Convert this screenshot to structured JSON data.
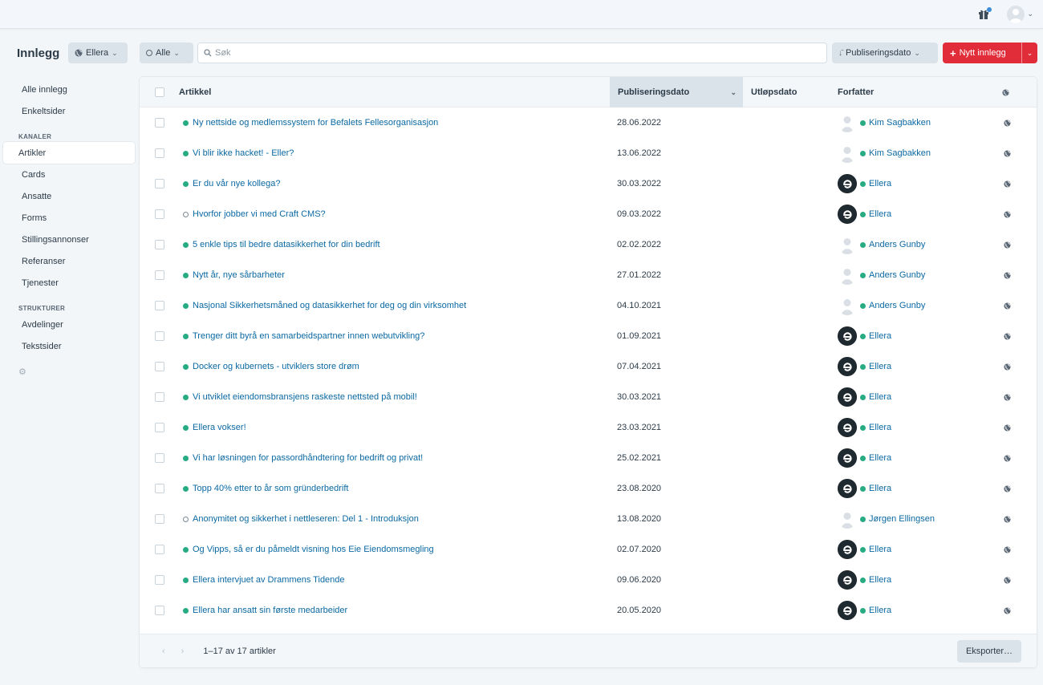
{
  "topbar": {
    "gift_icon": "gift-icon",
    "user_icon": "user-avatar"
  },
  "header": {
    "title": "Innlegg",
    "site_label": "Ellera",
    "status_label": "Alle",
    "search_placeholder": "Søk",
    "sort_label": "Publiseringsdato",
    "new_label": "Nytt innlegg"
  },
  "sidebar": {
    "top": [
      {
        "label": "Alle innlegg"
      },
      {
        "label": "Enkeltsider"
      }
    ],
    "kanaler_heading": "KANALER",
    "kanaler": [
      {
        "label": "Artikler",
        "selected": true
      },
      {
        "label": "Cards"
      },
      {
        "label": "Ansatte"
      },
      {
        "label": "Forms"
      },
      {
        "label": "Stillingsannonser"
      },
      {
        "label": "Referanser"
      },
      {
        "label": "Tjenester"
      }
    ],
    "strukturer_heading": "STRUKTURER",
    "strukturer": [
      {
        "label": "Avdelinger"
      },
      {
        "label": "Tekstsider"
      }
    ]
  },
  "table": {
    "columns": {
      "title": "Artikkel",
      "post_date": "Publiseringsdato",
      "expiry": "Utløpsdato",
      "author": "Forfatter"
    },
    "rows": [
      {
        "title": "Ny nettside og medlemssystem for Befalets Fellesorganisasjon",
        "enabled": true,
        "date": "28.06.2022",
        "author": "Kim Sagbakken",
        "logo": false
      },
      {
        "title": "Vi blir ikke hacket! - Eller?",
        "enabled": true,
        "date": "13.06.2022",
        "author": "Kim Sagbakken",
        "logo": false
      },
      {
        "title": "Er du vår nye kollega?",
        "enabled": true,
        "date": "30.03.2022",
        "author": "Ellera",
        "logo": true
      },
      {
        "title": "Hvorfor jobber vi med Craft CMS?",
        "enabled": false,
        "date": "09.03.2022",
        "author": "Ellera",
        "logo": true
      },
      {
        "title": "5 enkle tips til bedre datasikkerhet for din bedrift",
        "enabled": true,
        "date": "02.02.2022",
        "author": "Anders Gunby",
        "logo": false
      },
      {
        "title": "Nytt år, nye sårbarheter",
        "enabled": true,
        "date": "27.01.2022",
        "author": "Anders Gunby",
        "logo": false
      },
      {
        "title": "Nasjonal Sikkerhetsmåned og datasikkerhet for deg og din virksomhet",
        "enabled": true,
        "date": "04.10.2021",
        "author": "Anders Gunby",
        "logo": false
      },
      {
        "title": "Trenger ditt byrå en samarbeidspartner innen webutvikling?",
        "enabled": true,
        "date": "01.09.2021",
        "author": "Ellera",
        "logo": true
      },
      {
        "title": "Docker og kubernets - utviklers store drøm",
        "enabled": true,
        "date": "07.04.2021",
        "author": "Ellera",
        "logo": true
      },
      {
        "title": "Vi utviklet eiendomsbransjens raskeste nettsted på mobil!",
        "enabled": true,
        "date": "30.03.2021",
        "author": "Ellera",
        "logo": true
      },
      {
        "title": "Ellera vokser!",
        "enabled": true,
        "date": "23.03.2021",
        "author": "Ellera",
        "logo": true
      },
      {
        "title": "Vi har løsningen for passordhåndtering for bedrift og privat!",
        "enabled": true,
        "date": "25.02.2021",
        "author": "Ellera",
        "logo": true
      },
      {
        "title": "Topp 40% etter to år som gründerbedrift",
        "enabled": true,
        "date": "23.08.2020",
        "author": "Ellera",
        "logo": true
      },
      {
        "title": "Anonymitet og sikkerhet i nettleseren: Del 1 - Introduksjon",
        "enabled": false,
        "date": "13.08.2020",
        "author": "Jørgen Ellingsen",
        "logo": false
      },
      {
        "title": "Og Vipps, så er du påmeldt visning hos Eie Eiendomsmegling",
        "enabled": true,
        "date": "02.07.2020",
        "author": "Ellera",
        "logo": true
      },
      {
        "title": "Ellera intervjuet av Drammens Tidende",
        "enabled": true,
        "date": "09.06.2020",
        "author": "Ellera",
        "logo": true
      },
      {
        "title": "Ellera har ansatt sin første medarbeider",
        "enabled": true,
        "date": "20.05.2020",
        "author": "Ellera",
        "logo": true
      }
    ]
  },
  "footer": {
    "count": "1–17 av 17 artikler",
    "export_label": "Eksporter…"
  },
  "colors": {
    "accent_red": "#e12d39",
    "link": "#0b69a3",
    "enabled_green": "#27ab83"
  }
}
